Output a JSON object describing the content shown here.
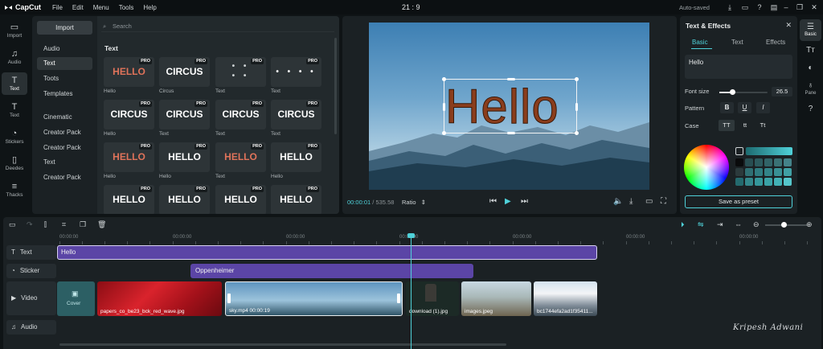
{
  "app": {
    "name": "CapCut",
    "menu": [
      "File",
      "Edit",
      "Menu",
      "Tools",
      "Help"
    ],
    "aspect": "21 : 9",
    "autosave": "Auto-saved"
  },
  "rail": {
    "items": [
      {
        "label": "Import",
        "icon": "folder-icon"
      },
      {
        "label": "Audio",
        "icon": "music-icon"
      },
      {
        "label": "Text",
        "icon": "text-icon"
      },
      {
        "label": "Text",
        "icon": "text-icon"
      },
      {
        "label": "Stickers",
        "icon": "sticker-icon"
      },
      {
        "label": "Deedes",
        "icon": "device-icon"
      },
      {
        "label": "Thacks",
        "icon": "list-icon"
      }
    ]
  },
  "media": {
    "import_label": "Import",
    "search_placeholder": "Search",
    "categories": [
      "Audio",
      "Text",
      "Toots",
      "Templates",
      "Cinematic",
      "Creator Pack",
      "Creator Pack",
      "Text",
      "Creator Pack"
    ],
    "section_title": "Text",
    "pro_badge": "PRO",
    "tiles": [
      {
        "text": "HELLO",
        "label": "Hello",
        "color": "#e0735a",
        "pro": true
      },
      {
        "text": "CIRCUS",
        "label": "Circus",
        "color": "#ffffff",
        "pro": true
      },
      {
        "text": "• •\n• •",
        "label": "Text",
        "color": "#cfd4d6",
        "pro": true
      },
      {
        "text": "• • • •",
        "label": "Text",
        "color": "#ffffff",
        "pro": true
      },
      {
        "text": "CIRCUS",
        "label": "Hello",
        "color": "#ffffff",
        "pro": true
      },
      {
        "text": "CIRCUS",
        "label": "Text",
        "color": "#ffffff",
        "pro": true
      },
      {
        "text": "CIRCUS",
        "label": "Text",
        "color": "#ffffff",
        "pro": true
      },
      {
        "text": "CIRCUS",
        "label": "Text",
        "color": "#ffffff",
        "pro": true
      },
      {
        "text": "HELLO",
        "label": "Hello",
        "color": "#e0735a",
        "pro": true
      },
      {
        "text": "HELLO",
        "label": "Hello",
        "color": "#ffffff",
        "pro": true
      },
      {
        "text": "HELLO",
        "label": "Text",
        "color": "#e0735a",
        "pro": true
      },
      {
        "text": "HELLO",
        "label": "Hello",
        "color": "#ffffff",
        "pro": true
      },
      {
        "text": "HELLO",
        "label": "",
        "color": "#ffffff",
        "pro": true
      },
      {
        "text": "HELLO",
        "label": "",
        "color": "#ffffff",
        "pro": true
      },
      {
        "text": "HELLO",
        "label": "",
        "color": "#ffffff",
        "pro": true
      },
      {
        "text": "HELLO",
        "label": "",
        "color": "#ffffff",
        "pro": true
      }
    ]
  },
  "preview": {
    "canvas_text": "Hello",
    "current_time": "00:00:01",
    "total_time": "535.58",
    "ratio_label": "Ratio"
  },
  "props": {
    "title": "Text & Effects",
    "tabs": [
      "Basic",
      "Text",
      "Effects"
    ],
    "text_value": "Hello",
    "font_size_label": "Font size",
    "font_size_value": "26.5",
    "font_size_fraction": 0.27,
    "pattern_label": "Pattern",
    "pattern_buttons": [
      "B",
      "U",
      "I"
    ],
    "case_label": "Case",
    "case_buttons": [
      "TT",
      "tt",
      "Tt"
    ],
    "preset_label": "Save as preset",
    "accent": "#4fd1d9"
  },
  "right_rail": {
    "items": [
      {
        "label": "Basic",
        "icon": "menu-icon"
      },
      {
        "label": "",
        "icon": "text-size-icon"
      },
      {
        "label": "",
        "icon": "circle-half-icon"
      },
      {
        "label": "Pane",
        "icon": "lightbulb-icon"
      },
      {
        "label": "",
        "icon": "help-icon"
      }
    ]
  },
  "timeline": {
    "ruler": [
      "00:00:00",
      "00:00:00",
      "00:00:00",
      "00:00:00",
      "00:00:00",
      "00:00:00",
      "00:00:00",
      "00:00:00",
      "00:00:00"
    ],
    "tracks": [
      {
        "label": "Text",
        "icon": "text-icon"
      },
      {
        "label": "Sticker",
        "icon": "sticker-icon"
      },
      {
        "label": "Video",
        "icon": "video-icon"
      },
      {
        "label": "Audio",
        "icon": "audio-icon"
      }
    ],
    "text_clip": "Hello",
    "sticker_clip": "Oppenheimer",
    "cover_label": "Cover",
    "video_clips": [
      {
        "name": "papers_co_be23_bck_red_wave.jpg"
      },
      {
        "name": "sky.mp4",
        "duration": "00:00:19"
      },
      {
        "name": "download (1).jpg"
      },
      {
        "name": "images.jpeg"
      },
      {
        "name": "bc1744efa2ad1f35411..."
      }
    ],
    "signature": "Kripesh Adwani"
  }
}
